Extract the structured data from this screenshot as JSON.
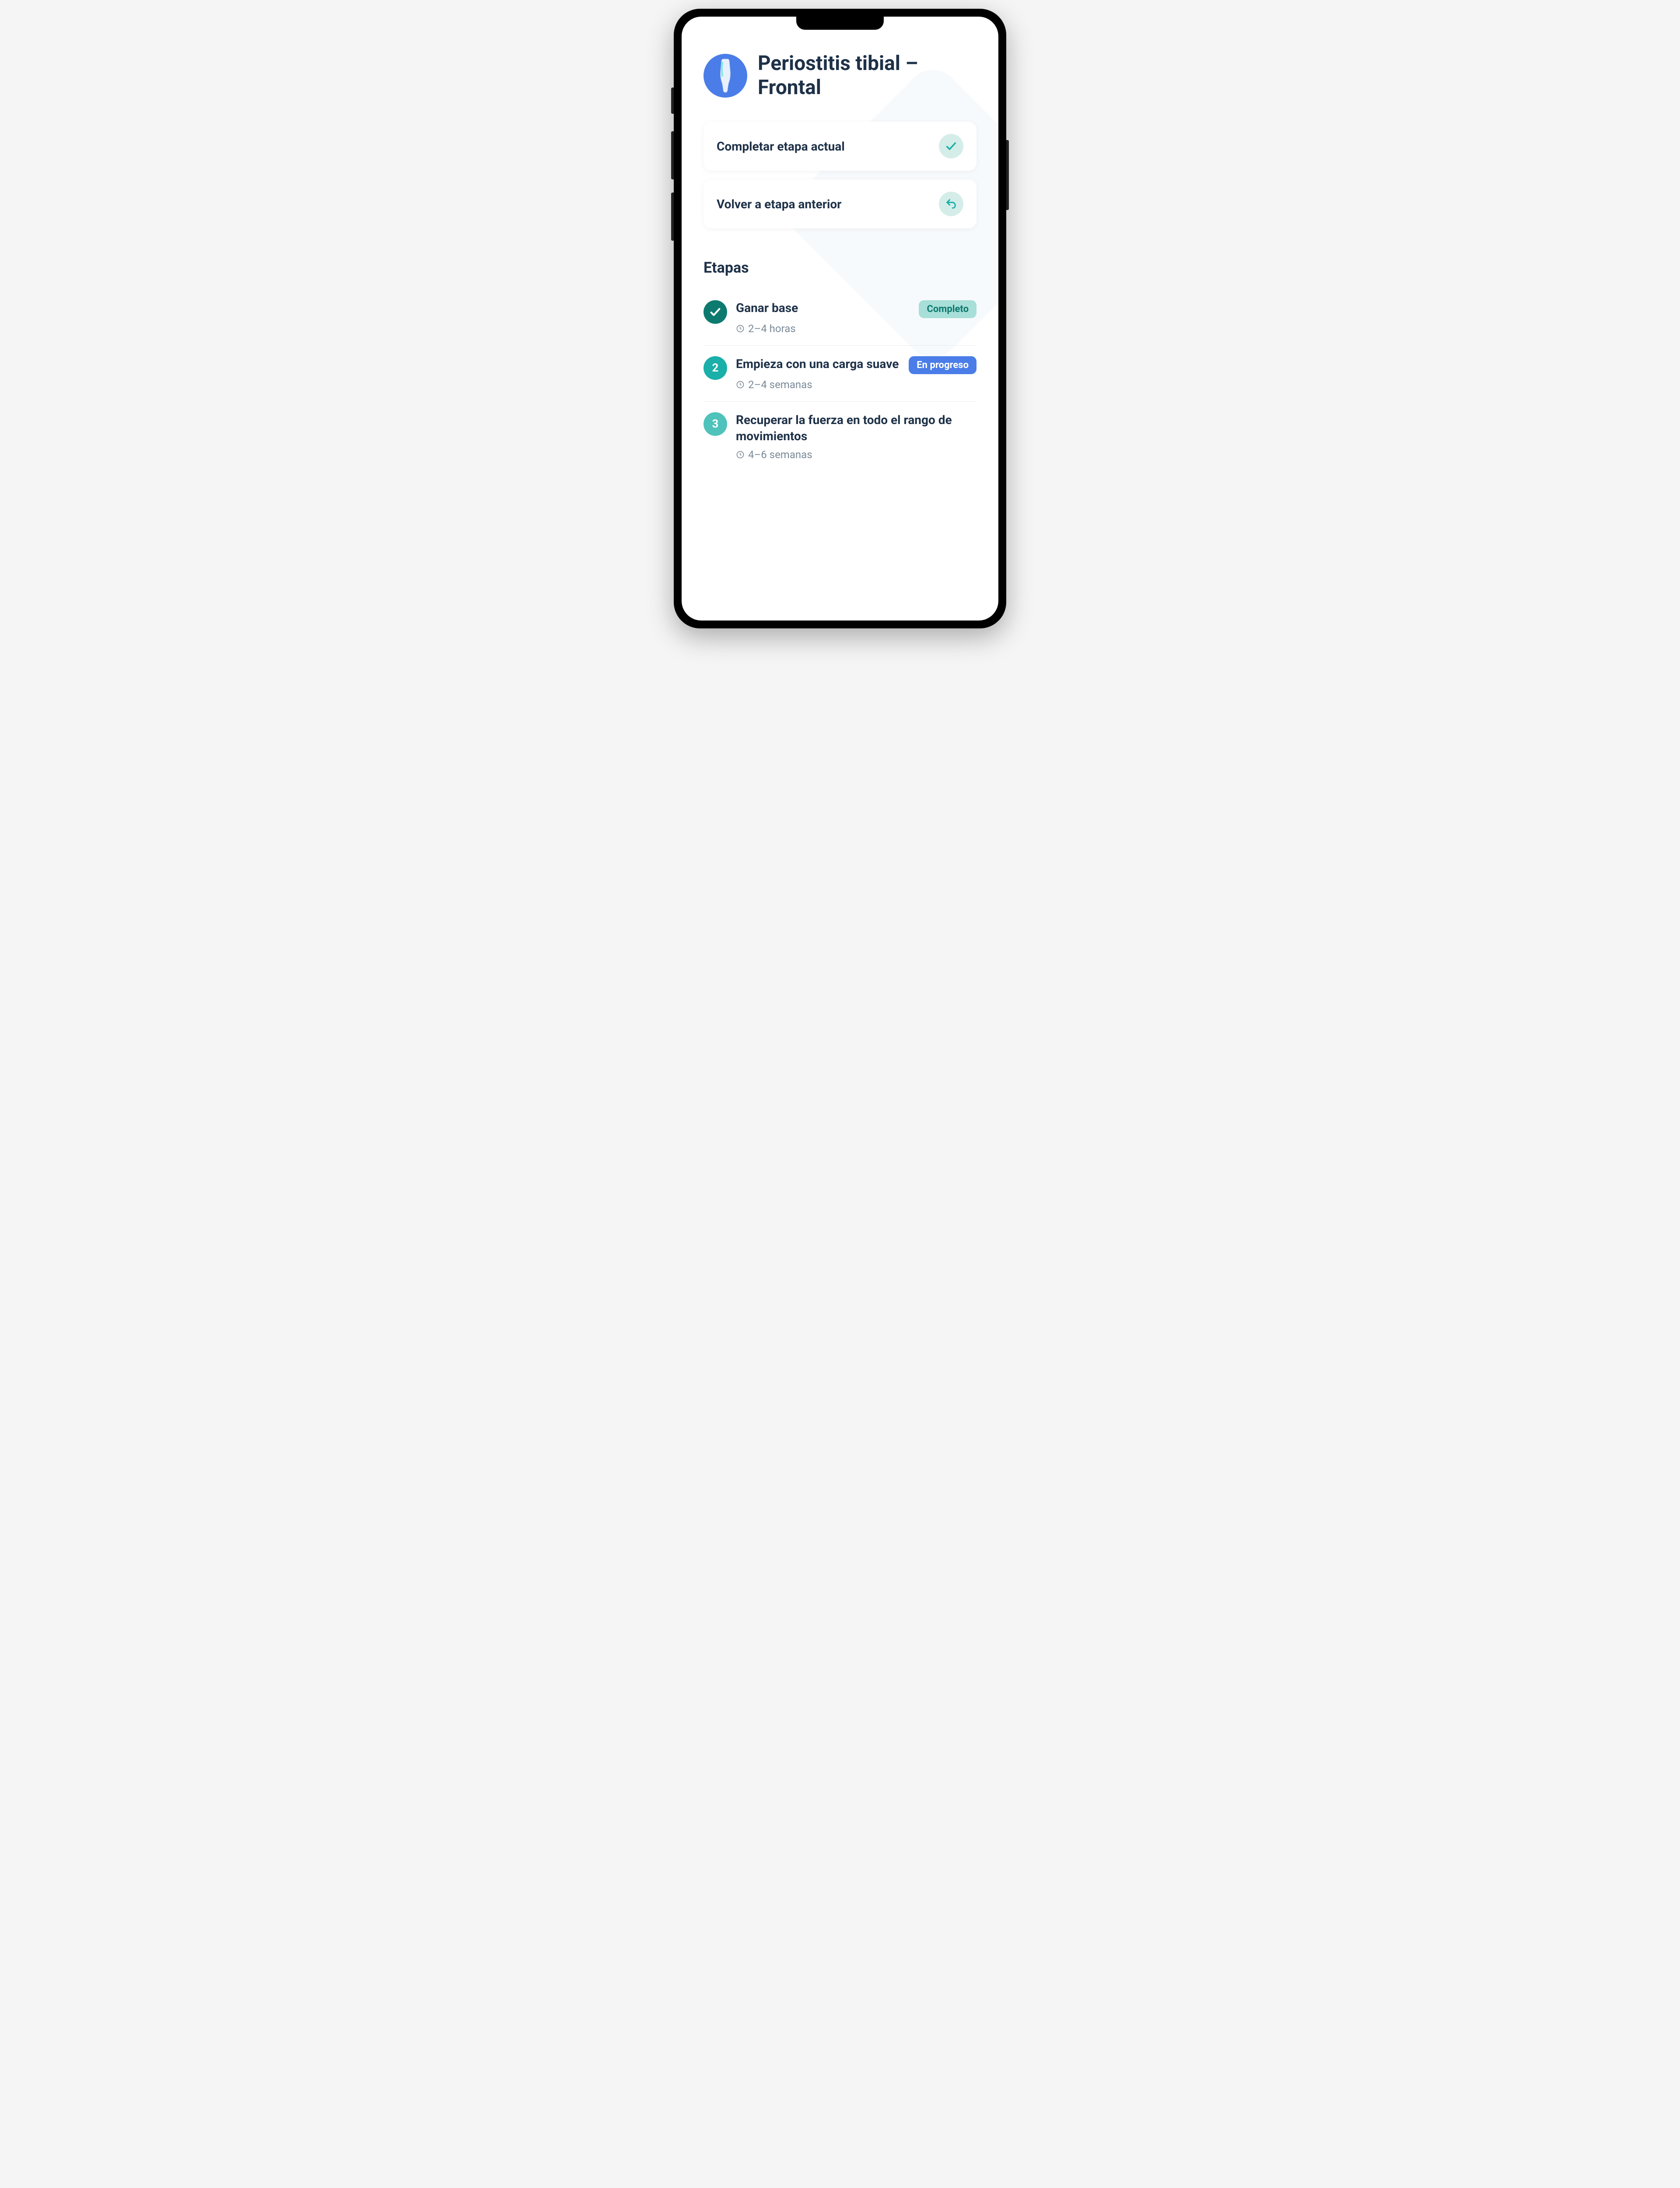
{
  "header": {
    "title": "Periostitis tibial – Frontal",
    "icon": "leg-icon"
  },
  "actions": {
    "complete": {
      "label": "Completar etapa actual",
      "icon": "check-icon"
    },
    "back": {
      "label": "Volver a etapa anterior",
      "icon": "undo-icon"
    }
  },
  "stages": {
    "section_title": "Etapas",
    "items": [
      {
        "number": "1",
        "done": true,
        "title": "Ganar base",
        "duration": "2–4 horas",
        "status_label": "Completo",
        "status_kind": "complete"
      },
      {
        "number": "2",
        "done": false,
        "title": "Empieza con una carga suave",
        "duration": "2–4 semanas",
        "status_label": "En progreso",
        "status_kind": "progress"
      },
      {
        "number": "3",
        "done": false,
        "title": "Recuperar la fuerza en todo el rango de movimientos",
        "duration": "4–6 semanas",
        "status_label": "",
        "status_kind": ""
      }
    ]
  },
  "colors": {
    "accent_blue": "#4a7de8",
    "teal_dark": "#0d7a6f",
    "teal": "#1aafa8",
    "teal_light": "#4ec2bb",
    "navy": "#1e3148"
  }
}
